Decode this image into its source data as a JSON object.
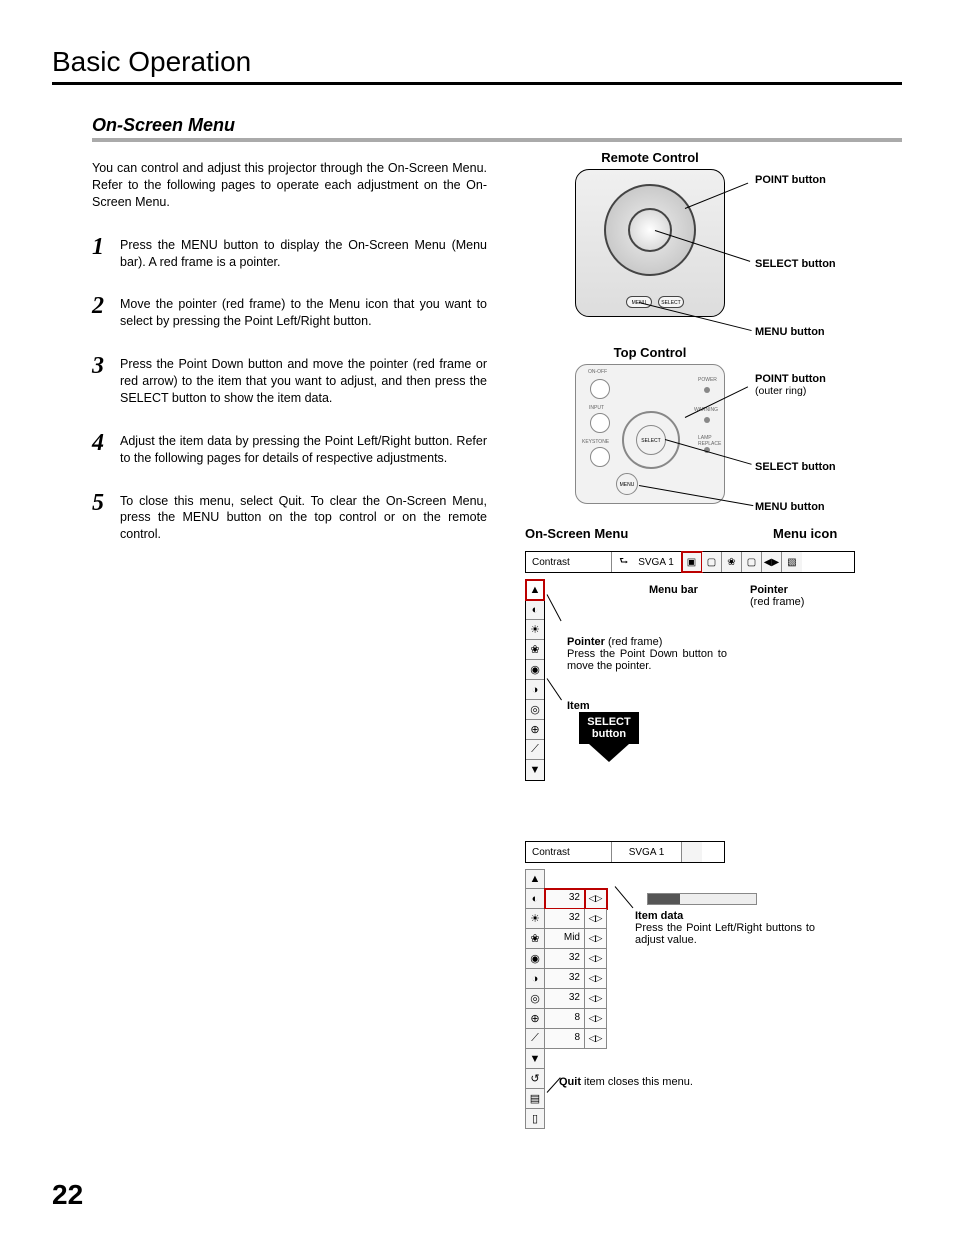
{
  "chapter": "Basic Operation",
  "section": "On-Screen Menu",
  "intro": "You can control and adjust this projector through the On-Screen Menu.  Refer to the following pages to operate each adjustment on the On-Screen Menu.",
  "steps": [
    "Press the MENU button to display the On-Screen Menu (Menu bar).  A red frame is a pointer.",
    "Move the pointer (red frame) to the Menu icon that you want to select by pressing the Point Left/Right button.",
    "Press the Point Down button and move the pointer (red frame or red arrow) to the item that you want to adjust, and then press the SELECT button to show the item data.",
    "Adjust the item data by pressing the Point Left/Right button.  Refer to the following pages for details of respective adjustments.",
    "To close this menu, select Quit.  To clear the On-Screen Menu, press the MENU button on the top control or on the remote control."
  ],
  "page_number": "22",
  "remote": {
    "title": "Remote Control",
    "callouts": {
      "point": "POINT button",
      "select": "SELECT button",
      "menu": "MENU button"
    },
    "labels": {
      "menu": "MENU",
      "select": "SELECT"
    }
  },
  "top_control": {
    "title": "Top Control",
    "callouts": {
      "point": "POINT button",
      "point_sub": "(outer ring)",
      "select": "SELECT button",
      "menu": "MENU button"
    },
    "labels": {
      "onoff": "ON-OFF",
      "input": "INPUT",
      "keystone": "KEYSTONE",
      "power": "POWER",
      "warning": "WARNING",
      "lamp": "LAMP REPLACE",
      "select": "SELECT",
      "menu": "MENU"
    }
  },
  "osm": {
    "header_left": "On-Screen Menu",
    "header_right": "Menu icon",
    "menubar": {
      "contrast": "Contrast",
      "svga": "SVGA 1"
    },
    "anno": {
      "menu_bar": "Menu bar",
      "pointer_top": "Pointer",
      "pointer_top_sub": "(red frame)",
      "pointer_side_b": "Pointer",
      "pointer_side_sub": " (red frame)",
      "pointer_side_text": "Press the Point Down button to move the pointer.",
      "item": "Item",
      "select_button_l1": "SELECT",
      "select_button_l2": "button",
      "item_data_b": "Item data",
      "item_data_text": "Press the Point Left/Right buttons to adjust value.",
      "quit_b": "Quit",
      "quit_text": " item closes this menu."
    },
    "data_rows": [
      {
        "value": "32"
      },
      {
        "value": "32"
      },
      {
        "value": "Mid"
      },
      {
        "value": "32"
      },
      {
        "value": "32"
      },
      {
        "value": "32"
      },
      {
        "value": "8"
      },
      {
        "value": "8"
      }
    ]
  }
}
